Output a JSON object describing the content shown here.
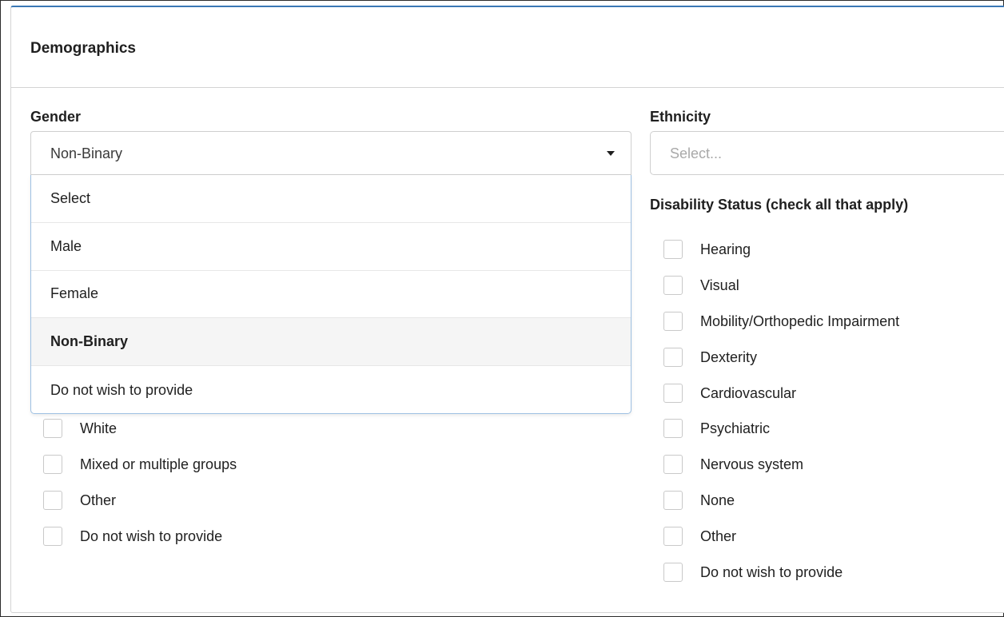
{
  "section": {
    "title": "Demographics"
  },
  "gender": {
    "label": "Gender",
    "selected_value": "Non-Binary",
    "options": [
      "Select",
      "Male",
      "Female",
      "Non-Binary",
      "Do not wish to provide"
    ]
  },
  "ethnicity": {
    "label": "Ethnicity",
    "placeholder": "Select...",
    "visible_checkboxes": [
      "White",
      "Mixed or multiple groups",
      "Other",
      "Do not wish to provide"
    ]
  },
  "disability": {
    "label": "Disability Status (check all that apply)",
    "options": [
      "Hearing",
      "Visual",
      "Mobility/Orthopedic Impairment",
      "Dexterity",
      "Cardiovascular",
      "Psychiatric",
      "Nervous system",
      "None",
      "Other",
      "Do not wish to provide"
    ]
  },
  "colors": {
    "accent_border": "#3a78b5",
    "dropdown_border": "#9ec0e2",
    "selected_option_bg": "#f5f5f5"
  },
  "icons": {
    "select_caret": "caret-down-icon"
  }
}
